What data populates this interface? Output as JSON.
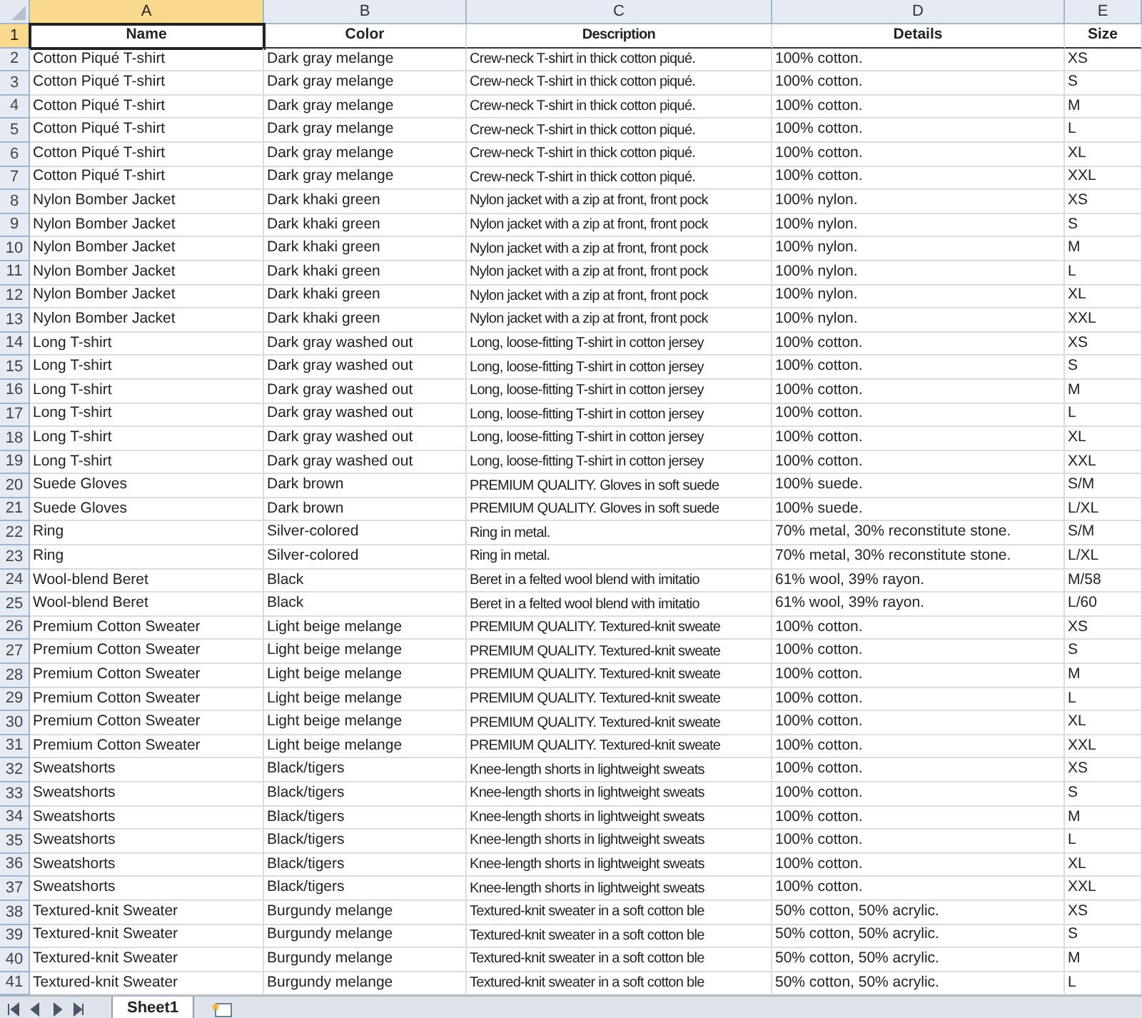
{
  "columns": [
    {
      "label": "A",
      "selected": true
    },
    {
      "label": "B",
      "selected": false
    },
    {
      "label": "C",
      "selected": false
    },
    {
      "label": "D",
      "selected": false
    },
    {
      "label": "E",
      "selected": false
    }
  ],
  "rows": [
    {
      "number": "1",
      "selected": true,
      "kind": "header",
      "cells": [
        "Name",
        "Color",
        "Description",
        "Details",
        "Size"
      ]
    },
    {
      "number": "2",
      "selected": false,
      "kind": "data",
      "cells": [
        "Cotton Piqué T-shirt",
        "Dark gray melange",
        "Crew-neck T-shirt in thick cotton piqué.",
        "100% cotton.",
        "XS"
      ]
    },
    {
      "number": "3",
      "selected": false,
      "kind": "data",
      "cells": [
        "Cotton Piqué T-shirt",
        "Dark gray melange",
        "Crew-neck T-shirt in thick cotton piqué.",
        "100% cotton.",
        "S"
      ]
    },
    {
      "number": "4",
      "selected": false,
      "kind": "data",
      "cells": [
        "Cotton Piqué T-shirt",
        "Dark gray melange",
        "Crew-neck T-shirt in thick cotton piqué.",
        "100% cotton.",
        "M"
      ]
    },
    {
      "number": "5",
      "selected": false,
      "kind": "data",
      "cells": [
        "Cotton Piqué T-shirt",
        "Dark gray melange",
        "Crew-neck T-shirt in thick cotton piqué.",
        "100% cotton.",
        "L"
      ]
    },
    {
      "number": "6",
      "selected": false,
      "kind": "data",
      "cells": [
        "Cotton Piqué T-shirt",
        "Dark gray melange",
        "Crew-neck T-shirt in thick cotton piqué.",
        "100% cotton.",
        "XL"
      ]
    },
    {
      "number": "7",
      "selected": false,
      "kind": "data",
      "cells": [
        "Cotton Piqué T-shirt",
        "Dark gray melange",
        "Crew-neck T-shirt in thick cotton piqué.",
        "100% cotton.",
        "XXL"
      ]
    },
    {
      "number": "8",
      "selected": false,
      "kind": "data",
      "cells": [
        "Nylon Bomber Jacket",
        "Dark khaki green",
        "Nylon jacket with a zip at front, front pock",
        "100% nylon.",
        "XS"
      ]
    },
    {
      "number": "9",
      "selected": false,
      "kind": "data",
      "cells": [
        "Nylon Bomber Jacket",
        "Dark khaki green",
        "Nylon jacket with a zip at front, front pock",
        "100% nylon.",
        "S"
      ]
    },
    {
      "number": "10",
      "selected": false,
      "kind": "data",
      "cells": [
        "Nylon Bomber Jacket",
        "Dark khaki green",
        "Nylon jacket with a zip at front, front pock",
        "100% nylon.",
        "M"
      ]
    },
    {
      "number": "11",
      "selected": false,
      "kind": "data",
      "cells": [
        "Nylon Bomber Jacket",
        "Dark khaki green",
        "Nylon jacket with a zip at front, front pock",
        "100% nylon.",
        "L"
      ]
    },
    {
      "number": "12",
      "selected": false,
      "kind": "data",
      "cells": [
        "Nylon Bomber Jacket",
        "Dark khaki green",
        "Nylon jacket with a zip at front, front pock",
        "100% nylon.",
        "XL"
      ]
    },
    {
      "number": "13",
      "selected": false,
      "kind": "data",
      "cells": [
        "Nylon Bomber Jacket",
        "Dark khaki green",
        "Nylon jacket with a zip at front, front pock",
        "100% nylon.",
        "XXL"
      ]
    },
    {
      "number": "14",
      "selected": false,
      "kind": "data",
      "cells": [
        "Long T-shirt",
        "Dark gray washed out",
        "Long, loose-fitting T-shirt in cotton jersey",
        "100% cotton.",
        "XS"
      ]
    },
    {
      "number": "15",
      "selected": false,
      "kind": "data",
      "cells": [
        "Long T-shirt",
        "Dark gray washed out",
        "Long, loose-fitting T-shirt in cotton jersey",
        "100% cotton.",
        "S"
      ]
    },
    {
      "number": "16",
      "selected": false,
      "kind": "data",
      "cells": [
        "Long T-shirt",
        "Dark gray washed out",
        "Long, loose-fitting T-shirt in cotton jersey",
        "100% cotton.",
        "M"
      ]
    },
    {
      "number": "17",
      "selected": false,
      "kind": "data",
      "cells": [
        "Long T-shirt",
        "Dark gray washed out",
        "Long, loose-fitting T-shirt in cotton jersey",
        "100% cotton.",
        "L"
      ]
    },
    {
      "number": "18",
      "selected": false,
      "kind": "data",
      "cells": [
        "Long T-shirt",
        "Dark gray washed out",
        "Long, loose-fitting T-shirt in cotton jersey",
        "100% cotton.",
        "XL"
      ]
    },
    {
      "number": "19",
      "selected": false,
      "kind": "data",
      "cells": [
        "Long T-shirt",
        "Dark gray washed out",
        "Long, loose-fitting T-shirt in cotton jersey",
        "100% cotton.",
        "XXL"
      ]
    },
    {
      "number": "20",
      "selected": false,
      "kind": "data",
      "cells": [
        "Suede Gloves",
        "Dark brown",
        "PREMIUM QUALITY. Gloves in soft suede",
        "100% suede.",
        "S/M"
      ]
    },
    {
      "number": "21",
      "selected": false,
      "kind": "data",
      "cells": [
        "Suede Gloves",
        "Dark brown",
        "PREMIUM QUALITY. Gloves in soft suede",
        "100% suede.",
        "L/XL"
      ]
    },
    {
      "number": "22",
      "selected": false,
      "kind": "data",
      "cells": [
        "Ring",
        "Silver-colored",
        "Ring in metal.",
        "70% metal, 30% reconstitute stone.",
        "S/M"
      ]
    },
    {
      "number": "23",
      "selected": false,
      "kind": "data",
      "cells": [
        "Ring",
        "Silver-colored",
        "Ring in metal.",
        "70% metal, 30% reconstitute stone.",
        "L/XL"
      ]
    },
    {
      "number": "24",
      "selected": false,
      "kind": "data",
      "cells": [
        "Wool-blend Beret",
        "Black",
        "Beret in a felted wool blend with imitatio",
        "61% wool, 39% rayon.",
        "M/58"
      ]
    },
    {
      "number": "25",
      "selected": false,
      "kind": "data",
      "cells": [
        "Wool-blend Beret",
        "Black",
        "Beret in a felted wool blend with imitatio",
        "61% wool, 39% rayon.",
        "L/60"
      ]
    },
    {
      "number": "26",
      "selected": false,
      "kind": "data",
      "cells": [
        "Premium Cotton Sweater",
        "Light beige melange",
        "PREMIUM QUALITY. Textured-knit sweate",
        "100% cotton.",
        "XS"
      ]
    },
    {
      "number": "27",
      "selected": false,
      "kind": "data",
      "cells": [
        "Premium Cotton Sweater",
        "Light beige melange",
        "PREMIUM QUALITY. Textured-knit sweate",
        "100% cotton.",
        "S"
      ]
    },
    {
      "number": "28",
      "selected": false,
      "kind": "data",
      "cells": [
        "Premium Cotton Sweater",
        "Light beige melange",
        "PREMIUM QUALITY. Textured-knit sweate",
        "100% cotton.",
        "M"
      ]
    },
    {
      "number": "29",
      "selected": false,
      "kind": "data",
      "cells": [
        "Premium Cotton Sweater",
        "Light beige melange",
        "PREMIUM QUALITY. Textured-knit sweate",
        "100% cotton.",
        "L"
      ]
    },
    {
      "number": "30",
      "selected": false,
      "kind": "data",
      "cells": [
        "Premium Cotton Sweater",
        "Light beige melange",
        "PREMIUM QUALITY. Textured-knit sweate",
        "100% cotton.",
        "XL"
      ]
    },
    {
      "number": "31",
      "selected": false,
      "kind": "data",
      "cells": [
        "Premium Cotton Sweater",
        "Light beige melange",
        "PREMIUM QUALITY. Textured-knit sweate",
        "100% cotton.",
        "XXL"
      ]
    },
    {
      "number": "32",
      "selected": false,
      "kind": "data",
      "cells": [
        "Sweatshorts",
        "Black/tigers",
        "Knee-length shorts in lightweight sweats",
        "100% cotton.",
        "XS"
      ]
    },
    {
      "number": "33",
      "selected": false,
      "kind": "data",
      "cells": [
        "Sweatshorts",
        "Black/tigers",
        "Knee-length shorts in lightweight sweats",
        "100% cotton.",
        "S"
      ]
    },
    {
      "number": "34",
      "selected": false,
      "kind": "data",
      "cells": [
        "Sweatshorts",
        "Black/tigers",
        "Knee-length shorts in lightweight sweats",
        "100% cotton.",
        "M"
      ]
    },
    {
      "number": "35",
      "selected": false,
      "kind": "data",
      "cells": [
        "Sweatshorts",
        "Black/tigers",
        "Knee-length shorts in lightweight sweats",
        "100% cotton.",
        "L"
      ]
    },
    {
      "number": "36",
      "selected": false,
      "kind": "data",
      "cells": [
        "Sweatshorts",
        "Black/tigers",
        "Knee-length shorts in lightweight sweats",
        "100% cotton.",
        "XL"
      ]
    },
    {
      "number": "37",
      "selected": false,
      "kind": "data",
      "cells": [
        "Sweatshorts",
        "Black/tigers",
        "Knee-length shorts in lightweight sweats",
        "100% cotton.",
        "XXL"
      ]
    },
    {
      "number": "38",
      "selected": false,
      "kind": "data",
      "cells": [
        "Textured-knit Sweater",
        "Burgundy melange",
        "Textured-knit sweater in a soft cotton ble",
        "50% cotton, 50% acrylic.",
        "XS"
      ]
    },
    {
      "number": "39",
      "selected": false,
      "kind": "data",
      "cells": [
        "Textured-knit Sweater",
        "Burgundy melange",
        "Textured-knit sweater in a soft cotton ble",
        "50% cotton, 50% acrylic.",
        "S"
      ]
    },
    {
      "number": "40",
      "selected": false,
      "kind": "data",
      "cells": [
        "Textured-knit Sweater",
        "Burgundy melange",
        "Textured-knit sweater in a soft cotton ble",
        "50% cotton, 50% acrylic.",
        "M"
      ]
    },
    {
      "number": "41",
      "selected": false,
      "kind": "data",
      "cells": [
        "Textured-knit Sweater",
        "Burgundy melange",
        "Textured-knit sweater in a soft cotton ble",
        "50% cotton, 50% acrylic.",
        "L"
      ]
    }
  ],
  "sheet_tabs": [
    {
      "label": "Sheet1",
      "selected": true
    }
  ]
}
